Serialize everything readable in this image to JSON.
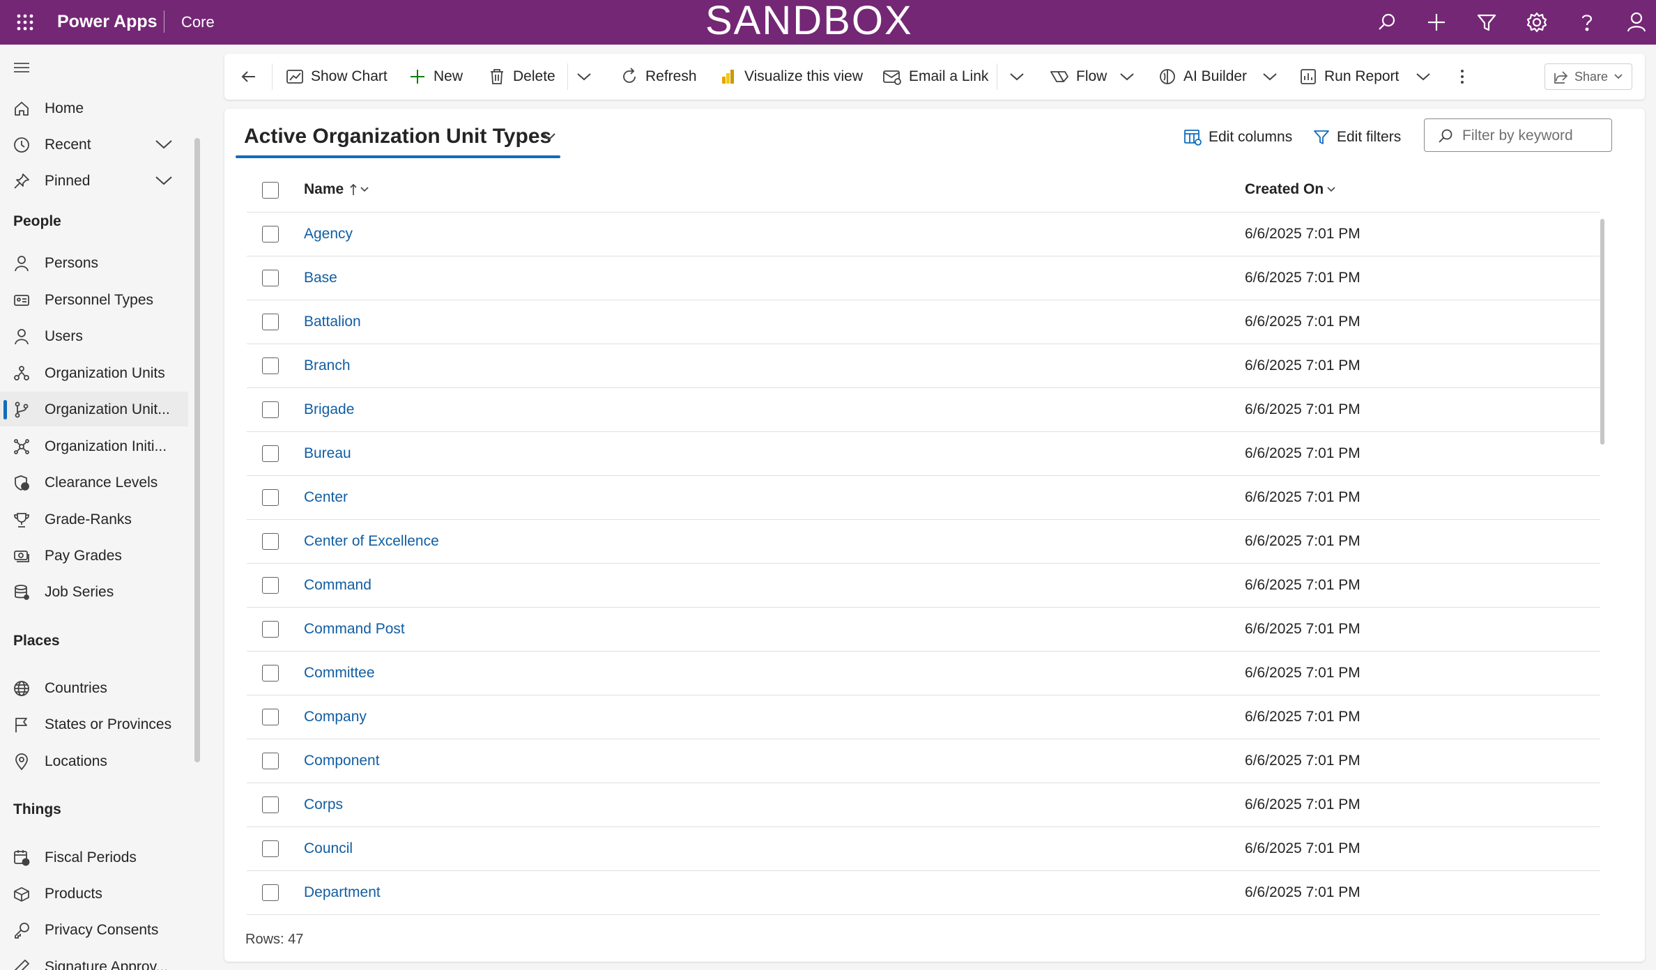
{
  "top_bar": {
    "app_name": "Power Apps",
    "environment": "Core",
    "banner": "SANDBOX",
    "icons": [
      "search-icon",
      "plus-icon",
      "filter-icon",
      "settings-icon",
      "help-icon",
      "user-icon"
    ],
    "background_color": "#742774"
  },
  "sidebar": {
    "top_items": [
      {
        "label": "Home",
        "icon": "home-icon"
      },
      {
        "label": "Recent",
        "icon": "clock-icon",
        "expandable": true
      },
      {
        "label": "Pinned",
        "icon": "pin-icon",
        "expandable": true
      }
    ],
    "groups": [
      {
        "title": "People",
        "items": [
          {
            "label": "Persons",
            "icon": "person-icon"
          },
          {
            "label": "Personnel Types",
            "icon": "id-card-icon"
          },
          {
            "label": "Users",
            "icon": "person-icon"
          },
          {
            "label": "Organization Units",
            "icon": "org-chart-icon"
          },
          {
            "label": "Organization Unit...",
            "icon": "branch-icon",
            "selected": true
          },
          {
            "label": "Organization Initi...",
            "icon": "network-icon"
          },
          {
            "label": "Clearance Levels",
            "icon": "shield-clock-icon"
          },
          {
            "label": "Grade-Ranks",
            "icon": "trophy-icon"
          },
          {
            "label": "Pay Grades",
            "icon": "money-icon"
          },
          {
            "label": "Job Series",
            "icon": "database-icon"
          }
        ]
      },
      {
        "title": "Places",
        "items": [
          {
            "label": "Countries",
            "icon": "globe-icon"
          },
          {
            "label": "States or Provinces",
            "icon": "flag-icon"
          },
          {
            "label": "Locations",
            "icon": "location-icon"
          }
        ]
      },
      {
        "title": "Things",
        "items": [
          {
            "label": "Fiscal Periods",
            "icon": "calendar-icon"
          },
          {
            "label": "Products",
            "icon": "box-icon"
          },
          {
            "label": "Privacy Consents",
            "icon": "key-icon"
          },
          {
            "label": "Signature Approv...",
            "icon": "pen-icon"
          }
        ]
      }
    ]
  },
  "command_bar": {
    "back_icon": "back-arrow-icon",
    "show_chart": "Show Chart",
    "new": "New",
    "delete": "Delete",
    "refresh": "Refresh",
    "visualize": "Visualize this view",
    "email_link": "Email a Link",
    "flow": "Flow",
    "ai_builder": "AI Builder",
    "run_report": "Run Report",
    "share": "Share"
  },
  "view": {
    "title": "Active Organization Unit Types",
    "edit_columns": "Edit columns",
    "edit_filters": "Edit filters",
    "filter_placeholder": "Filter by keyword",
    "columns": {
      "name": "Name",
      "created_on": "Created On"
    },
    "rows": [
      {
        "name": "Agency",
        "created_on": "6/6/2025 7:01 PM"
      },
      {
        "name": "Base",
        "created_on": "6/6/2025 7:01 PM"
      },
      {
        "name": "Battalion",
        "created_on": "6/6/2025 7:01 PM"
      },
      {
        "name": "Branch",
        "created_on": "6/6/2025 7:01 PM"
      },
      {
        "name": "Brigade",
        "created_on": "6/6/2025 7:01 PM"
      },
      {
        "name": "Bureau",
        "created_on": "6/6/2025 7:01 PM"
      },
      {
        "name": "Center",
        "created_on": "6/6/2025 7:01 PM"
      },
      {
        "name": "Center of Excellence",
        "created_on": "6/6/2025 7:01 PM"
      },
      {
        "name": "Command",
        "created_on": "6/6/2025 7:01 PM"
      },
      {
        "name": "Command Post",
        "created_on": "6/6/2025 7:01 PM"
      },
      {
        "name": "Committee",
        "created_on": "6/6/2025 7:01 PM"
      },
      {
        "name": "Company",
        "created_on": "6/6/2025 7:01 PM"
      },
      {
        "name": "Component",
        "created_on": "6/6/2025 7:01 PM"
      },
      {
        "name": "Corps",
        "created_on": "6/6/2025 7:01 PM"
      },
      {
        "name": "Council",
        "created_on": "6/6/2025 7:01 PM"
      },
      {
        "name": "Department",
        "created_on": "6/6/2025 7:01 PM"
      }
    ],
    "row_count": "Rows: 47"
  }
}
